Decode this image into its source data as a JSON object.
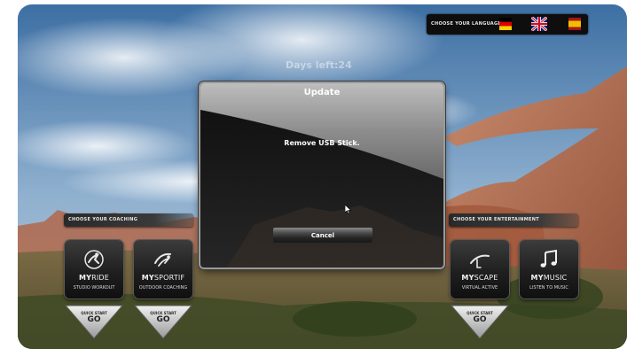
{
  "app": {
    "days_left": "Days left:24"
  },
  "language_bar": {
    "label": "CHOOSE YOUR LANGUAGE",
    "flags": [
      {
        "name": "german-flag-icon",
        "colors": [
          "#000000",
          "#dd0000",
          "#ffce00"
        ]
      },
      {
        "name": "uk-flag-icon",
        "colors": [
          "#012169",
          "#ffffff",
          "#c8102e"
        ]
      },
      {
        "name": "spain-flag-icon",
        "colors": [
          "#aa151b",
          "#f1bf00"
        ]
      }
    ]
  },
  "coaching": {
    "label": "CHOOSE YOUR COACHING",
    "tiles": [
      {
        "title_bold": "MY",
        "title_lite": "RIDE",
        "subtitle": "STUDIO WORKOUT",
        "icon": "cyclist-icon"
      },
      {
        "title_bold": "MY",
        "title_lite": "SPORTIF",
        "subtitle": "OUTDOOR COACHING",
        "icon": "sportif-rider-icon"
      }
    ]
  },
  "entertainment": {
    "label": "CHOOSE YOUR ENTERTAINMENT",
    "tiles": [
      {
        "title_bold": "MY",
        "title_lite": "SCAPE",
        "subtitle": "VIRTUAL ACTIVE",
        "icon": "landscape-icon"
      },
      {
        "title_bold": "MY",
        "title_lite": "MUSIC",
        "subtitle": "LISTEN TO MUSIC",
        "icon": "music-note-icon"
      }
    ]
  },
  "quick_start": {
    "small_label": "QUICK START",
    "go_label": "GO"
  },
  "dialog": {
    "title": "Update",
    "message": "Remove USB Stick.",
    "cancel_label": "Cancel"
  },
  "colors": {
    "sky_top": "#3d6fa3",
    "rock": "#b2674a",
    "tile_dark": "#1f1f1f",
    "go_silver": "#c9c9c9"
  }
}
